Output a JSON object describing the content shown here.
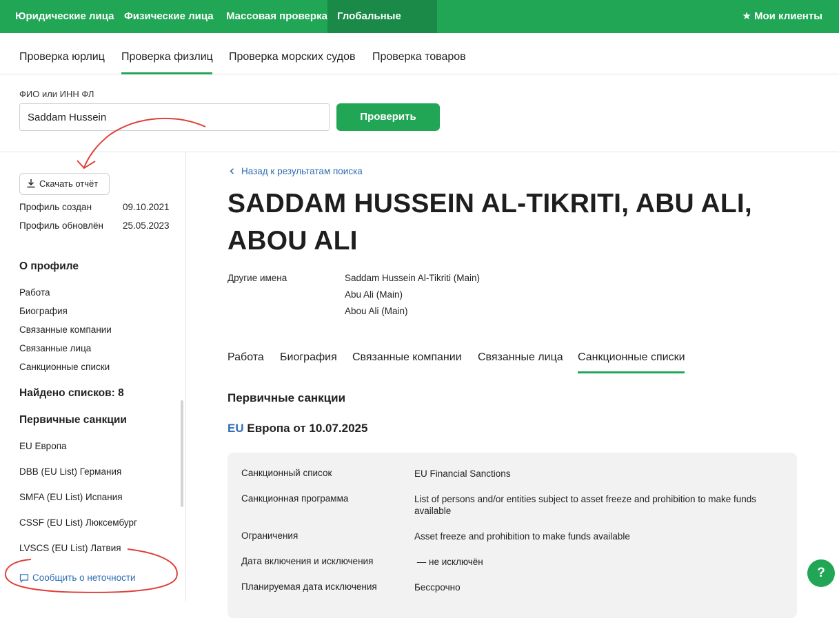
{
  "topbar": {
    "tabs": [
      "Юридические лица",
      "Физические лица",
      "Массовая проверка",
      "Глобальные списки"
    ],
    "my_clients": "Мои клиенты"
  },
  "subnav": [
    "Проверка юрлиц",
    "Проверка физлиц",
    "Проверка морских судов",
    "Проверка товаров"
  ],
  "search": {
    "label": "ФИО или ИНН ФЛ",
    "value": "Saddam Hussein",
    "button": "Проверить"
  },
  "sidebar": {
    "download": "Скачать отчёт",
    "created_label": "Профиль создан",
    "created_value": "09.10.2021",
    "updated_label": "Профиль обновлён",
    "updated_value": "25.05.2023",
    "about_heading": "О профиле",
    "about_links": [
      "Работа",
      "Биография",
      "Связанные компании",
      "Связанные лица",
      "Санкционные списки"
    ],
    "found_lists": "Найдено списков: 8",
    "primary_heading": "Первичные санкции",
    "sanction_links": [
      "EU Европа",
      "DBB (EU List) Германия",
      "SMFA (EU List) Испания",
      "CSSF (EU List) Люксембург",
      "LVSCS (EU List) Латвия"
    ],
    "report_issue": "Сообщить о неточности"
  },
  "main": {
    "back": "Назад к результатам поиска",
    "title": "SADDAM HUSSEIN AL-TIKRITI, ABU ALI, ABOU ALI",
    "other_names_label": "Другие имена",
    "other_names": [
      "Saddam Hussein Al-Tikriti (Main)",
      "Abu Ali (Main)",
      "Abou Ali (Main)"
    ],
    "tabs": [
      "Работа",
      "Биография",
      "Связанные компании",
      "Связанные лица",
      "Санкционные списки"
    ],
    "section_title": "Первичные санкции",
    "list_code": "EU",
    "list_title": "Европа от 10.07.2025",
    "details": [
      {
        "label": "Санкционный список",
        "value": "EU Financial Sanctions"
      },
      {
        "label": "Санкционная программа",
        "value": "List of persons and/or entities subject to asset freeze and prohibition to make funds available"
      },
      {
        "label": "Ограничения",
        "value": "Asset freeze and prohibition to make funds available"
      },
      {
        "label": "Дата включения и исключения",
        "value": " — не исключён"
      },
      {
        "label": "Планируемая дата исключения",
        "value": "Бессрочно"
      }
    ]
  },
  "help_button": "?",
  "colors": {
    "brand_green": "#21a656",
    "active_tab": "#1b8a48",
    "link_blue": "#2e6db3",
    "annotation_red": "#e0403a"
  }
}
